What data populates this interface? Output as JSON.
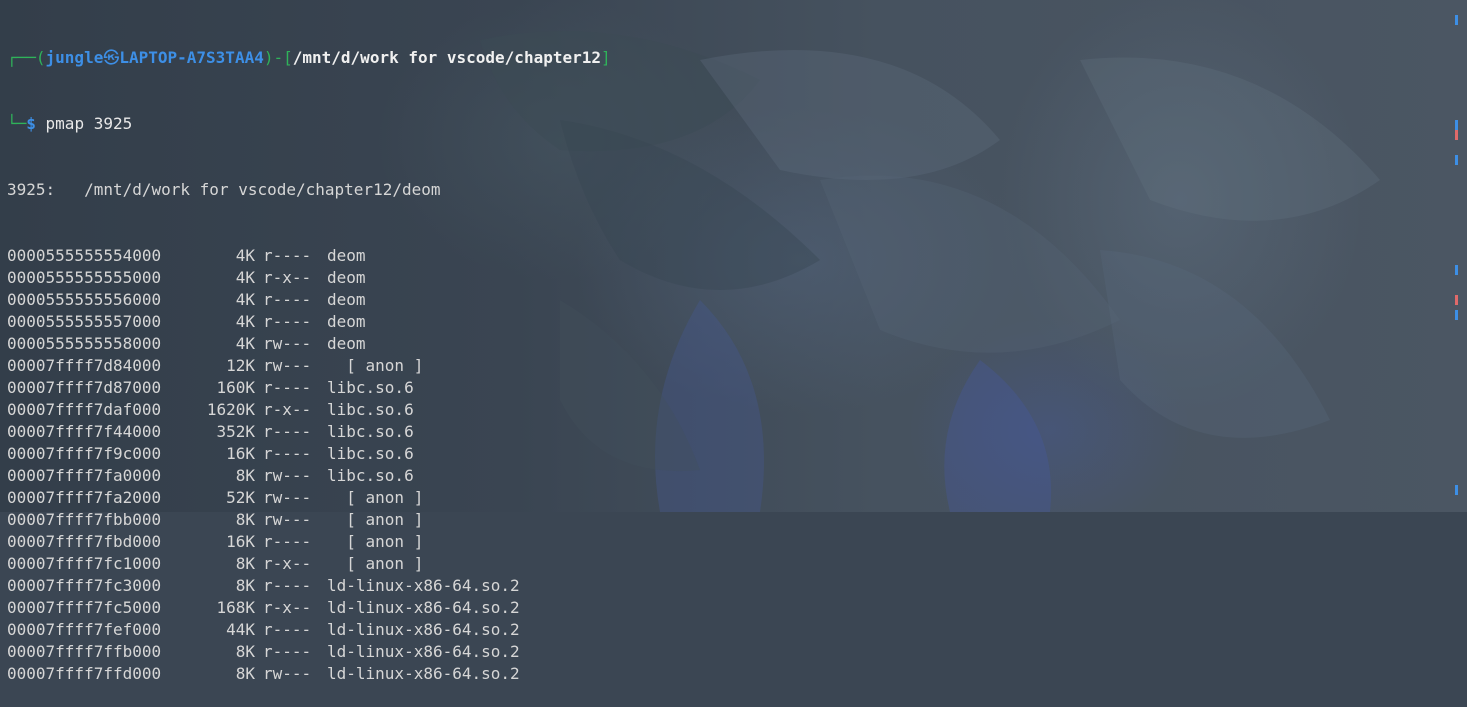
{
  "prompt": {
    "frame_top": "┌──(",
    "user": "jungle",
    "skull": "㉿",
    "host": "LAPTOP-A7S3TAA4",
    "frame_mid": ")-[",
    "path": "/mnt/d/work for vscode/chapter12",
    "frame_end": "]",
    "frame_bottom": "└─",
    "dollar": "$",
    "command": " pmap 3925"
  },
  "header": {
    "pid_label": "3925:",
    "exe_path": "/mnt/d/work for vscode/chapter12/deom"
  },
  "mappings": [
    {
      "addr": "0000555555554000",
      "size": "4K",
      "mode": "r----",
      "name": "deom"
    },
    {
      "addr": "0000555555555000",
      "size": "4K",
      "mode": "r-x--",
      "name": "deom"
    },
    {
      "addr": "0000555555556000",
      "size": "4K",
      "mode": "r----",
      "name": "deom"
    },
    {
      "addr": "0000555555557000",
      "size": "4K",
      "mode": "r----",
      "name": "deom"
    },
    {
      "addr": "0000555555558000",
      "size": "4K",
      "mode": "rw---",
      "name": "deom"
    },
    {
      "addr": "00007ffff7d84000",
      "size": "12K",
      "mode": "rw---",
      "name": "  [ anon ]"
    },
    {
      "addr": "00007ffff7d87000",
      "size": "160K",
      "mode": "r----",
      "name": "libc.so.6"
    },
    {
      "addr": "00007ffff7daf000",
      "size": "1620K",
      "mode": "r-x--",
      "name": "libc.so.6"
    },
    {
      "addr": "00007ffff7f44000",
      "size": "352K",
      "mode": "r----",
      "name": "libc.so.6"
    },
    {
      "addr": "00007ffff7f9c000",
      "size": "16K",
      "mode": "r----",
      "name": "libc.so.6"
    },
    {
      "addr": "00007ffff7fa0000",
      "size": "8K",
      "mode": "rw---",
      "name": "libc.so.6"
    },
    {
      "addr": "00007ffff7fa2000",
      "size": "52K",
      "mode": "rw---",
      "name": "  [ anon ]"
    },
    {
      "addr": "00007ffff7fbb000",
      "size": "8K",
      "mode": "rw---",
      "name": "  [ anon ]"
    },
    {
      "addr": "00007ffff7fbd000",
      "size": "16K",
      "mode": "r----",
      "name": "  [ anon ]"
    },
    {
      "addr": "00007ffff7fc1000",
      "size": "8K",
      "mode": "r-x--",
      "name": "  [ anon ]"
    },
    {
      "addr": "00007ffff7fc3000",
      "size": "8K",
      "mode": "r----",
      "name": "ld-linux-x86-64.so.2"
    },
    {
      "addr": "00007ffff7fc5000",
      "size": "168K",
      "mode": "r-x--",
      "name": "ld-linux-x86-64.so.2"
    },
    {
      "addr": "00007ffff7fef000",
      "size": "44K",
      "mode": "r----",
      "name": "ld-linux-x86-64.so.2"
    },
    {
      "addr": "00007ffff7ffb000",
      "size": "8K",
      "mode": "r----",
      "name": "ld-linux-x86-64.so.2"
    },
    {
      "addr": "00007ffff7ffd000",
      "size": "8K",
      "mode": "rw---",
      "name": "ld-linux-x86-64.so.2"
    }
  ],
  "scrollbar_marks": [
    {
      "color": "#3d8fe6",
      "pos": 0.03
    },
    {
      "color": "#3d8fe6",
      "pos": 0.24
    },
    {
      "color": "#e06a6a",
      "pos": 0.26
    },
    {
      "color": "#3d8fe6",
      "pos": 0.31
    },
    {
      "color": "#3d8fe6",
      "pos": 0.53
    },
    {
      "color": "#e06a6a",
      "pos": 0.59
    },
    {
      "color": "#3d8fe6",
      "pos": 0.62
    },
    {
      "color": "#3d8fe6",
      "pos": 0.97
    }
  ]
}
